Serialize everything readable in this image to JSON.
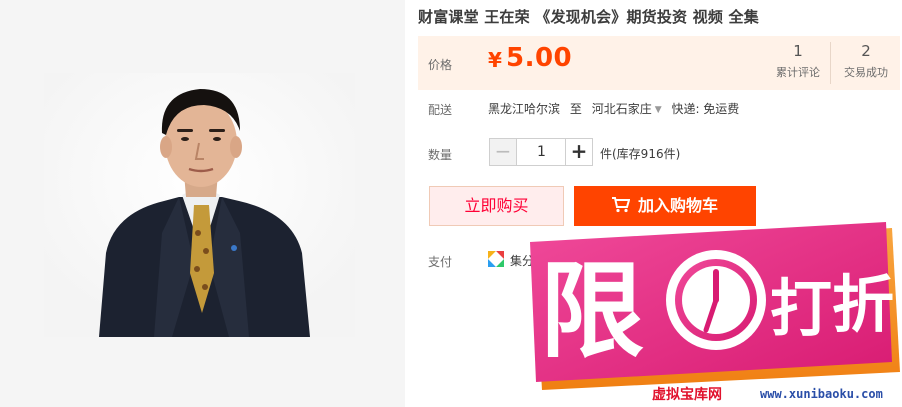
{
  "product": {
    "title": "财富课堂 王在荣 《发现机会》期货投资 视频 全集"
  },
  "price": {
    "label": "价格",
    "symbol": "¥",
    "value": "5.00",
    "reviews_count": "1",
    "reviews_label": "累计评论",
    "trades_count": "2",
    "trades_label": "交易成功"
  },
  "shipping": {
    "label": "配送",
    "from": "黑龙江哈尔滨",
    "to_word": "至",
    "to": "河北石家庄",
    "method": "快递: 免运费"
  },
  "quantity": {
    "label": "数量",
    "minus": "−",
    "value": "1",
    "plus": "+",
    "stock": "件(库存916件)"
  },
  "actions": {
    "buy_now": "立即购买",
    "add_to_cart": "加入购物车"
  },
  "payment": {
    "label": "支付",
    "method": "集分宝"
  },
  "promo": {
    "char_left": "限",
    "char_right_1": "打",
    "char_right_2": "折",
    "site_name": "虚拟宝库网",
    "site_url": "www.xunibaoku.com"
  },
  "colors": {
    "accent": "#ff4400",
    "price": "#ff4400",
    "promo_pink": "#ea2a86",
    "promo_orange": "#f6931f"
  }
}
